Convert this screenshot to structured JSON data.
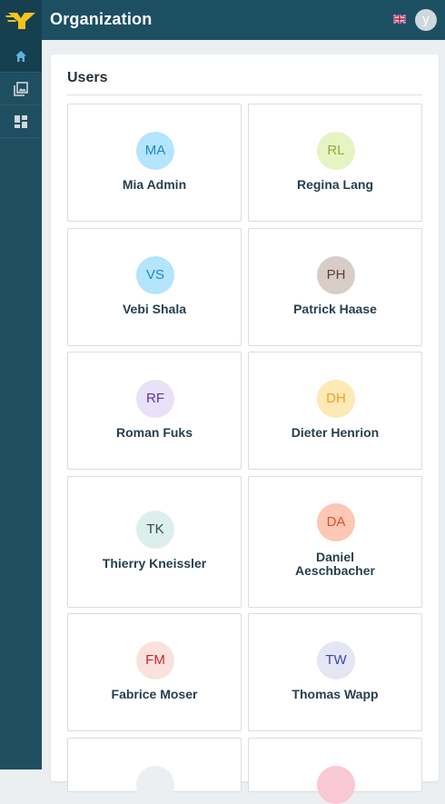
{
  "header": {
    "title": "Organization",
    "language_icon": "uk-flag-icon",
    "user_initial": "y"
  },
  "sidebar": {
    "items": [
      {
        "icon": "home-icon",
        "active": true
      },
      {
        "icon": "gallery-icon",
        "active": false
      },
      {
        "icon": "dashboard-icon",
        "active": false
      }
    ]
  },
  "main": {
    "section_title": "Users"
  },
  "users": [
    {
      "initials": "MA",
      "name": "Mia Admin",
      "bg": "#b3e5fc",
      "fg": "#1e88c8"
    },
    {
      "initials": "RL",
      "name": "Regina Lang",
      "bg": "#e6f4c4",
      "fg": "#9aa832"
    },
    {
      "initials": "VS",
      "name": "Vebi Shala",
      "bg": "#b3e5fc",
      "fg": "#1e88c8"
    },
    {
      "initials": "PH",
      "name": "Patrick Haase",
      "bg": "#d7ccc8",
      "fg": "#5d4037"
    },
    {
      "initials": "RF",
      "name": "Roman Fuks",
      "bg": "#e9e1f5",
      "fg": "#5e35b1"
    },
    {
      "initials": "DH",
      "name": "Dieter Henrion",
      "bg": "#fde9b6",
      "fg": "#f0a020"
    },
    {
      "initials": "TK",
      "name": "Thierry Kneissler",
      "bg": "#dcefec",
      "fg": "#37474f"
    },
    {
      "initials": "DA",
      "name": "Daniel Aeschbacher",
      "name_line1": "Daniel",
      "name_line2": "Aeschbacher",
      "bg": "#fcc7b5",
      "fg": "#d8532d"
    },
    {
      "initials": "FM",
      "name": "Fabrice Moser",
      "bg": "#fbe1de",
      "fg": "#c62828"
    },
    {
      "initials": "TW",
      "name": "Thomas Wapp",
      "bg": "#e6e5f4",
      "fg": "#3949ab"
    }
  ]
}
